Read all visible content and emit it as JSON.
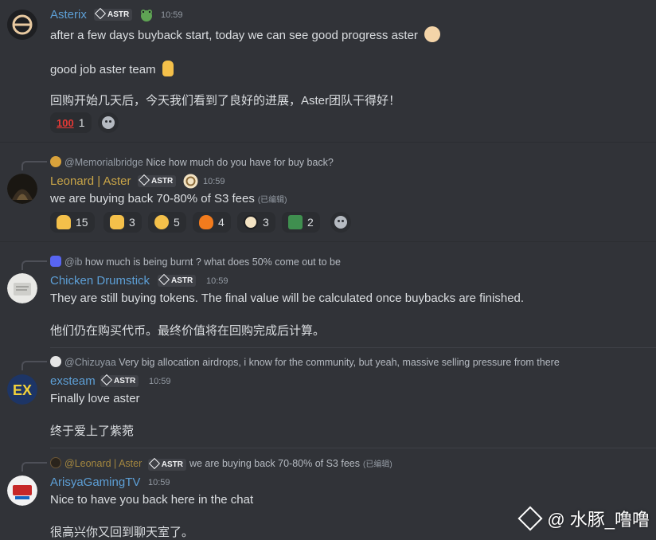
{
  "colors": {
    "background": "#313338",
    "username_default": "#5d9fd6",
    "username_gold": "#c9a548",
    "timestamp": "#949ba4"
  },
  "messages": [
    {
      "username": "Asterix",
      "tag": "ASTR",
      "time": "10:59",
      "lines": [
        "after a few days buyback start, today we can see good progress aster",
        "good job aster team",
        "回购开始几天后，今天我们看到了良好的进展，Aster团队干得好！"
      ],
      "reactions": [
        {
          "emoji": "100-icon",
          "count": "1"
        }
      ]
    },
    {
      "reply_user": "@Memorialbridge",
      "reply_text": "Nice how much do you have for buy back?",
      "username": "Leonard | Aster",
      "tag": "ASTR",
      "time": "10:59",
      "lines": [
        "we are buying back 70-80% of S3 fees"
      ],
      "edited": "(已编辑)",
      "reactions": [
        {
          "emoji": "pray-icon",
          "count": "15"
        },
        {
          "emoji": "handshake-icon",
          "count": "3"
        },
        {
          "emoji": "saluting-face-icon",
          "count": "5"
        },
        {
          "emoji": "fire-icon",
          "count": "4"
        },
        {
          "emoji": "aster-logo-icon",
          "count": "3"
        },
        {
          "emoji": "stonks-icon",
          "count": "2"
        }
      ]
    },
    {
      "reply_user": "@ib",
      "reply_text": "how much is being burnt ? what does 50% come out to be",
      "username": "Chicken Drumstick",
      "tag": "ASTR",
      "time": "10:59",
      "lines": [
        "They are still buying tokens. The final value will be calculated once buybacks are finished.",
        "他们仍在购买代币。最终价值将在回购完成后计算。"
      ]
    },
    {
      "reply_user": "@Chizuyaa",
      "reply_text": "Very big allocation airdrops, i know for the community, but yeah, massive selling pressure from there",
      "username": "exsteam",
      "tag": "ASTR",
      "time": "10:59",
      "lines": [
        "Finally love aster",
        "终于爱上了紫菀"
      ]
    },
    {
      "reply_user": "@Leonard | Aster",
      "reply_tag": "ASTR",
      "reply_text": "we are buying back 70-80% of S3 fees",
      "reply_edited": "(已编辑)",
      "username": "ArisyaGamingTV",
      "time": "10:59",
      "lines": [
        "Nice to have you back here in the chat",
        "很高兴你又回到聊天室了。"
      ]
    }
  ],
  "watermark": "@ 水豚_噜噜"
}
